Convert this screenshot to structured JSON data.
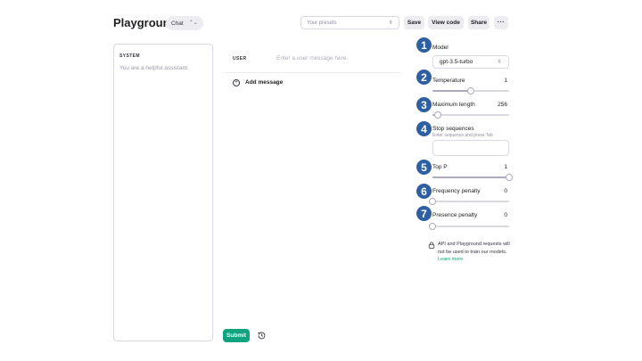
{
  "header": {
    "title": "Playground",
    "mode": "Chat",
    "presets_placeholder": "Your presets",
    "save_label": "Save",
    "view_code_label": "View code",
    "share_label": "Share",
    "more_label": "···"
  },
  "system": {
    "label": "SYSTEM",
    "placeholder": "You are a helpful assistant."
  },
  "chat": {
    "user_label": "USER",
    "user_placeholder": "Enter a user message here.",
    "add_message_label": "Add message",
    "submit_label": "Submit"
  },
  "settings": {
    "model": {
      "number": "1",
      "label": "Model",
      "value": "gpt-3.5-turbo"
    },
    "temperature": {
      "number": "2",
      "label": "Temperature",
      "value": "1",
      "level": 0.5
    },
    "maximum_length": {
      "number": "3",
      "label": "Maximum length",
      "value": "256",
      "level": 0.07
    },
    "stop_sequences": {
      "number": "4",
      "label": "Stop sequences",
      "hint": "Enter sequence and press Tab"
    },
    "top_p": {
      "number": "5",
      "label": "Top P",
      "value": "1",
      "level": 1.0
    },
    "frequency_penalty": {
      "number": "6",
      "label": "Frequency penalty",
      "value": "0",
      "level": 0.0
    },
    "presence_penalty": {
      "number": "7",
      "label": "Presence penalty",
      "value": "0",
      "level": 0.0
    }
  },
  "notice": {
    "text": "API and Playground requests will not be used to train our models.",
    "link": "Learn more"
  },
  "colors": {
    "accent": "#10a37f",
    "badge": "#2e5fa3",
    "border": "#d9d9e3"
  }
}
